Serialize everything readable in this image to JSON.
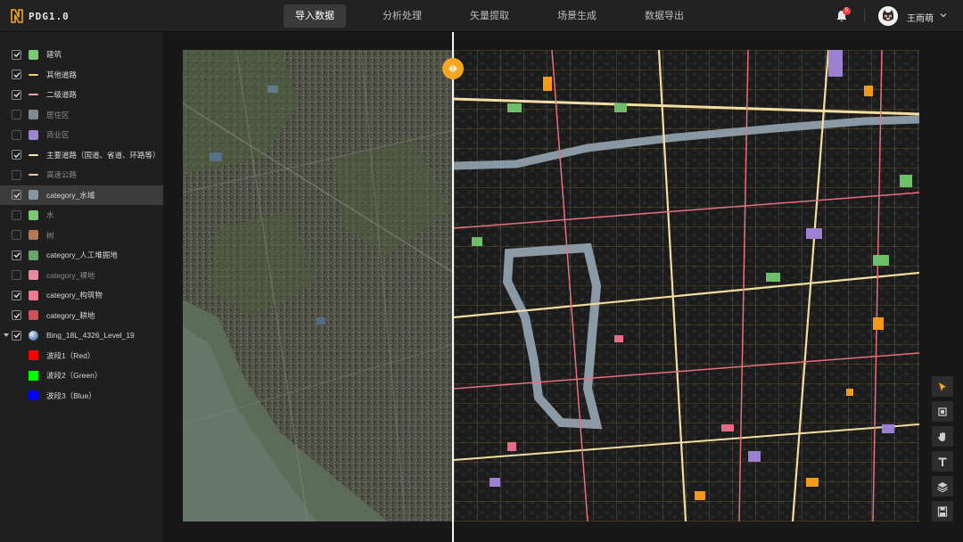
{
  "app": {
    "title": "PDG1.0"
  },
  "nav": [
    {
      "label": "导入数据",
      "active": true
    },
    {
      "label": "分析处理",
      "active": false
    },
    {
      "label": "矢量提取",
      "active": false
    },
    {
      "label": "场景生成",
      "active": false
    },
    {
      "label": "数据导出",
      "active": false
    }
  ],
  "notifications": {
    "count": "5"
  },
  "user": {
    "name": "王雨萌",
    "avatar_icon": "cat-avatar-icon"
  },
  "layers": [
    {
      "label": "建筑",
      "checked": true,
      "swatch": "#7dc67a",
      "kind": "fill"
    },
    {
      "label": "其他道路",
      "checked": true,
      "swatch": "#f2d47a",
      "kind": "line"
    },
    {
      "label": "二级道路",
      "checked": true,
      "swatch": "#f4a6a6",
      "kind": "line"
    },
    {
      "label": "居住区",
      "checked": false,
      "swatch": "#7f8a93",
      "kind": "fill"
    },
    {
      "label": "商业区",
      "checked": false,
      "swatch": "#9b87c9",
      "kind": "fill"
    },
    {
      "label": "主要道路（国道、省道、环路等）",
      "checked": true,
      "swatch": "#f7e5a3",
      "kind": "line"
    },
    {
      "label": "高速公路",
      "checked": false,
      "swatch": "#f0c7a8",
      "kind": "line"
    },
    {
      "label": "category_水域",
      "checked": true,
      "swatch": "#8895a0",
      "kind": "fill",
      "selected": true
    },
    {
      "label": "水",
      "checked": false,
      "swatch": "#7dc67a",
      "kind": "fill"
    },
    {
      "label": "树",
      "checked": false,
      "swatch": "#b27a56",
      "kind": "fill"
    },
    {
      "label": "category_人工堆掘地",
      "checked": true,
      "swatch": "#6fa36d",
      "kind": "fill"
    },
    {
      "label": "category_裸地",
      "checked": false,
      "swatch": "#e78ca0",
      "kind": "fill"
    },
    {
      "label": "category_构筑物",
      "checked": true,
      "swatch": "#ee7b93",
      "kind": "fill"
    },
    {
      "label": "category_耕地",
      "checked": true,
      "swatch": "#c9525d",
      "kind": "fill"
    },
    {
      "label": "Bing_18L_4326_Level_19",
      "checked": true,
      "swatch": "raster",
      "kind": "raster",
      "expanded": true
    }
  ],
  "bands": [
    {
      "label": "波段1（Red）",
      "color": "#ff0000"
    },
    {
      "label": "波段2（Green）",
      "color": "#00ff00"
    },
    {
      "label": "波段3（Blue）",
      "color": "#0000ff"
    }
  ],
  "map": {
    "accent": "#f5a623",
    "left_view": "satellite-imagery",
    "right_view": "vector-overlay"
  },
  "tools": [
    {
      "name": "pointer-tool",
      "icon": "cursor-arrow-icon",
      "active": true
    },
    {
      "name": "select-tool",
      "icon": "square-icon",
      "active": false
    },
    {
      "name": "pan-tool",
      "icon": "hand-icon",
      "active": false
    },
    {
      "name": "text-tool",
      "icon": "text-t-icon",
      "active": false
    },
    {
      "name": "layers-tool",
      "icon": "layers-stack-icon",
      "active": false
    },
    {
      "name": "save-tool",
      "icon": "floppy-icon",
      "active": false
    }
  ]
}
